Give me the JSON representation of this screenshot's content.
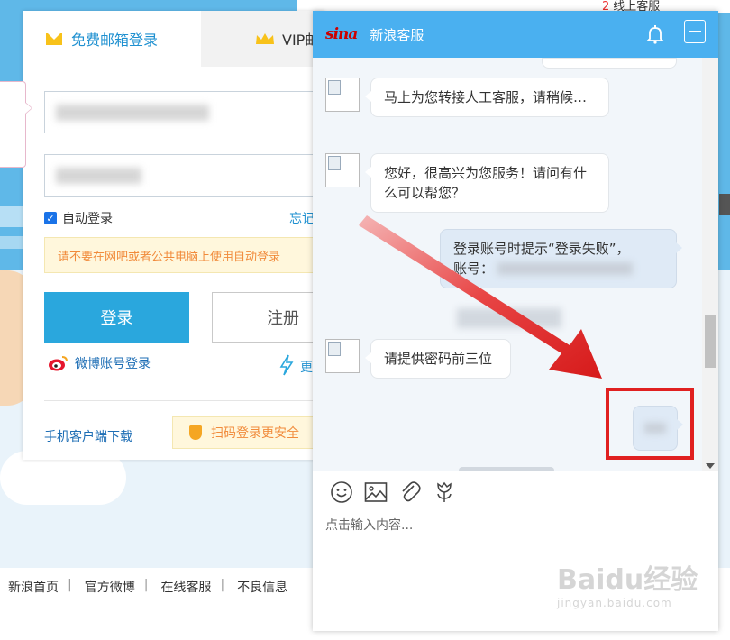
{
  "login": {
    "tab_free": "免费邮箱登录",
    "tab_vip": "VIP邮",
    "auto_login": "自动登录",
    "forget": "忘记",
    "warning": "请不要在网吧或者公共电脑上使用自动登录",
    "login_button": "登录",
    "register_button": "注册",
    "weibo_login": "微博账号登录",
    "more": "更",
    "mobile_download": "手机客户端下载",
    "qr_login": "扫码登录更安全"
  },
  "background": {
    "top_right_num": "2",
    "top_right_text": "线上客服"
  },
  "footer": {
    "links": [
      "新浪首页",
      "官方微博",
      "在线客服",
      "不良信息"
    ]
  },
  "chat": {
    "logo": "sina",
    "title": "新浪客服",
    "messages": [
      {
        "side": "left",
        "text": "马上为您转接人工客服，请稍候…"
      },
      {
        "side": "left",
        "text": "您好，很高兴为您服务！请问有什么可以帮您？"
      },
      {
        "side": "right",
        "text_line1": "登录账号时提示“登录失败”，",
        "text_line2": "账号："
      },
      {
        "side": "left",
        "text": "请提供密码前三位"
      }
    ],
    "input_placeholder": "点击输入内容..."
  },
  "watermark": {
    "main": "Baidu经验",
    "sub": "jingyan.baidu.com"
  },
  "colors": {
    "chat_header": "#4ab0f0",
    "login_button": "#2aa7dd",
    "highlight": "#e02020"
  }
}
